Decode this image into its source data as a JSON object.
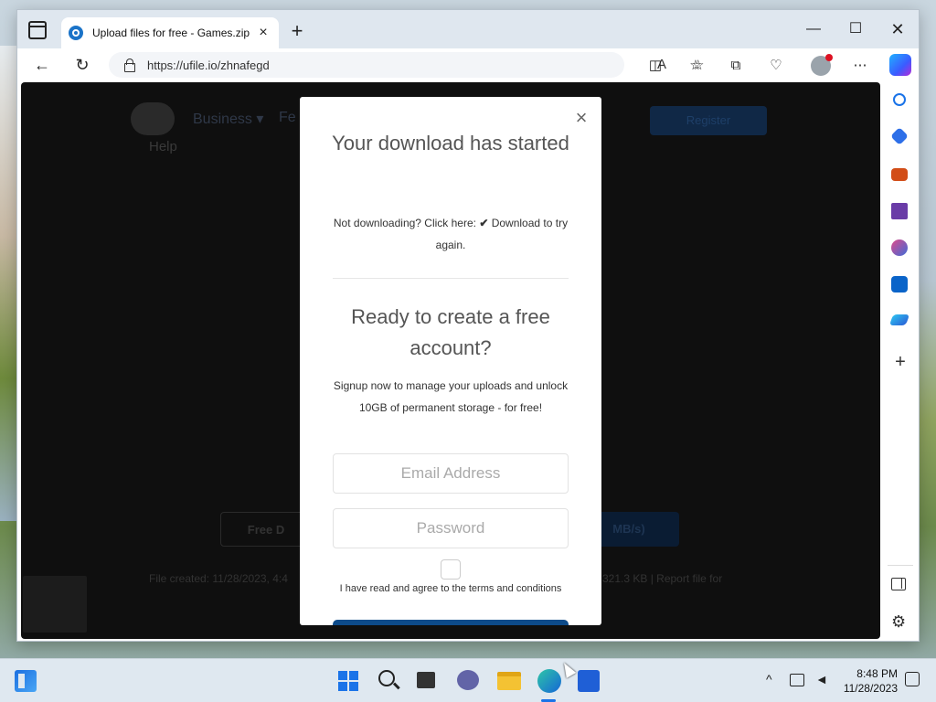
{
  "browser": {
    "tab_title": "Upload files for free - Games.zip",
    "tab_close": "×",
    "new_tab": "+",
    "url": "https://ufile.io/zhnafegd",
    "minimize": "—",
    "maximize": "☐",
    "close": "✕",
    "read_aloud": "A",
    "back": "←",
    "reload": "↻"
  },
  "background_page": {
    "nav_business": "Business ▾",
    "nav_features_partial": "Fe",
    "help": "Help",
    "register": "Register",
    "free_download_partial": "Free D",
    "premium_partial": "MB/s)",
    "file_created_partial": "File created: 11/28/2023, 4:4",
    "file_size_partial": "321.3 KB  |  Report file for"
  },
  "modal": {
    "close": "×",
    "title": "Your download has started",
    "not_downloading_prefix": "Not downloading? Click here: ",
    "check_glyph": "✔",
    "not_downloading_link": " Download to try again.",
    "ready_title": "Ready to create a free account?",
    "signup_text": "Signup now to manage your uploads and unlock 10GB of permanent storage - for free!",
    "email_placeholder": "Email Address",
    "password_placeholder": "Password",
    "terms_label": "I have read and agree to the terms and conditions"
  },
  "sidebar": {
    "add": "+",
    "settings": "⚙"
  },
  "taskbar": {
    "time": "8:48 PM",
    "date": "11/28/2023",
    "tray_chevron": "^"
  },
  "colors": {
    "modal_button": "#0d4b8a",
    "page_overlay": "#0f0f0f",
    "taskbar": "#dfe8f0"
  }
}
